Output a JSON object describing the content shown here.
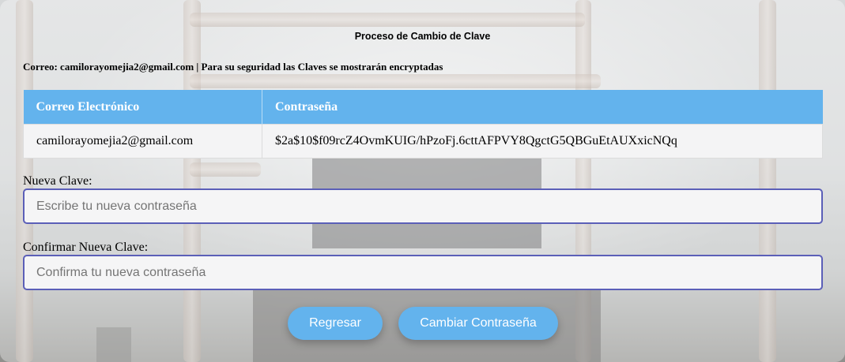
{
  "page": {
    "title": "Proceso de Cambio de Clave",
    "subtitle": "Correo: camilorayomejia2@gmail.com | Para su seguridad las Claves se mostrarán encryptadas"
  },
  "table": {
    "headers": [
      "Correo Electrónico",
      "Contraseña"
    ],
    "rows": [
      [
        "camilorayomejia2@gmail.com",
        "$2a$10$f09rcZ4OvmKUIG/hPzoFj.6cttAFPVY8QgctG5QBGuEtAUXxicNQq"
      ]
    ]
  },
  "form": {
    "new_password": {
      "label": "Nueva Clave:",
      "placeholder": "Escribe tu nueva contraseña",
      "value": ""
    },
    "confirm_password": {
      "label": "Confirmar Nueva Clave:",
      "placeholder": "Confirma tu nueva contraseña",
      "value": ""
    }
  },
  "buttons": {
    "back_label": "Regresar",
    "submit_label": "Cambiar Contraseña"
  },
  "colors": {
    "accent": "#63b3ed",
    "input_border": "#5b5fb8"
  }
}
